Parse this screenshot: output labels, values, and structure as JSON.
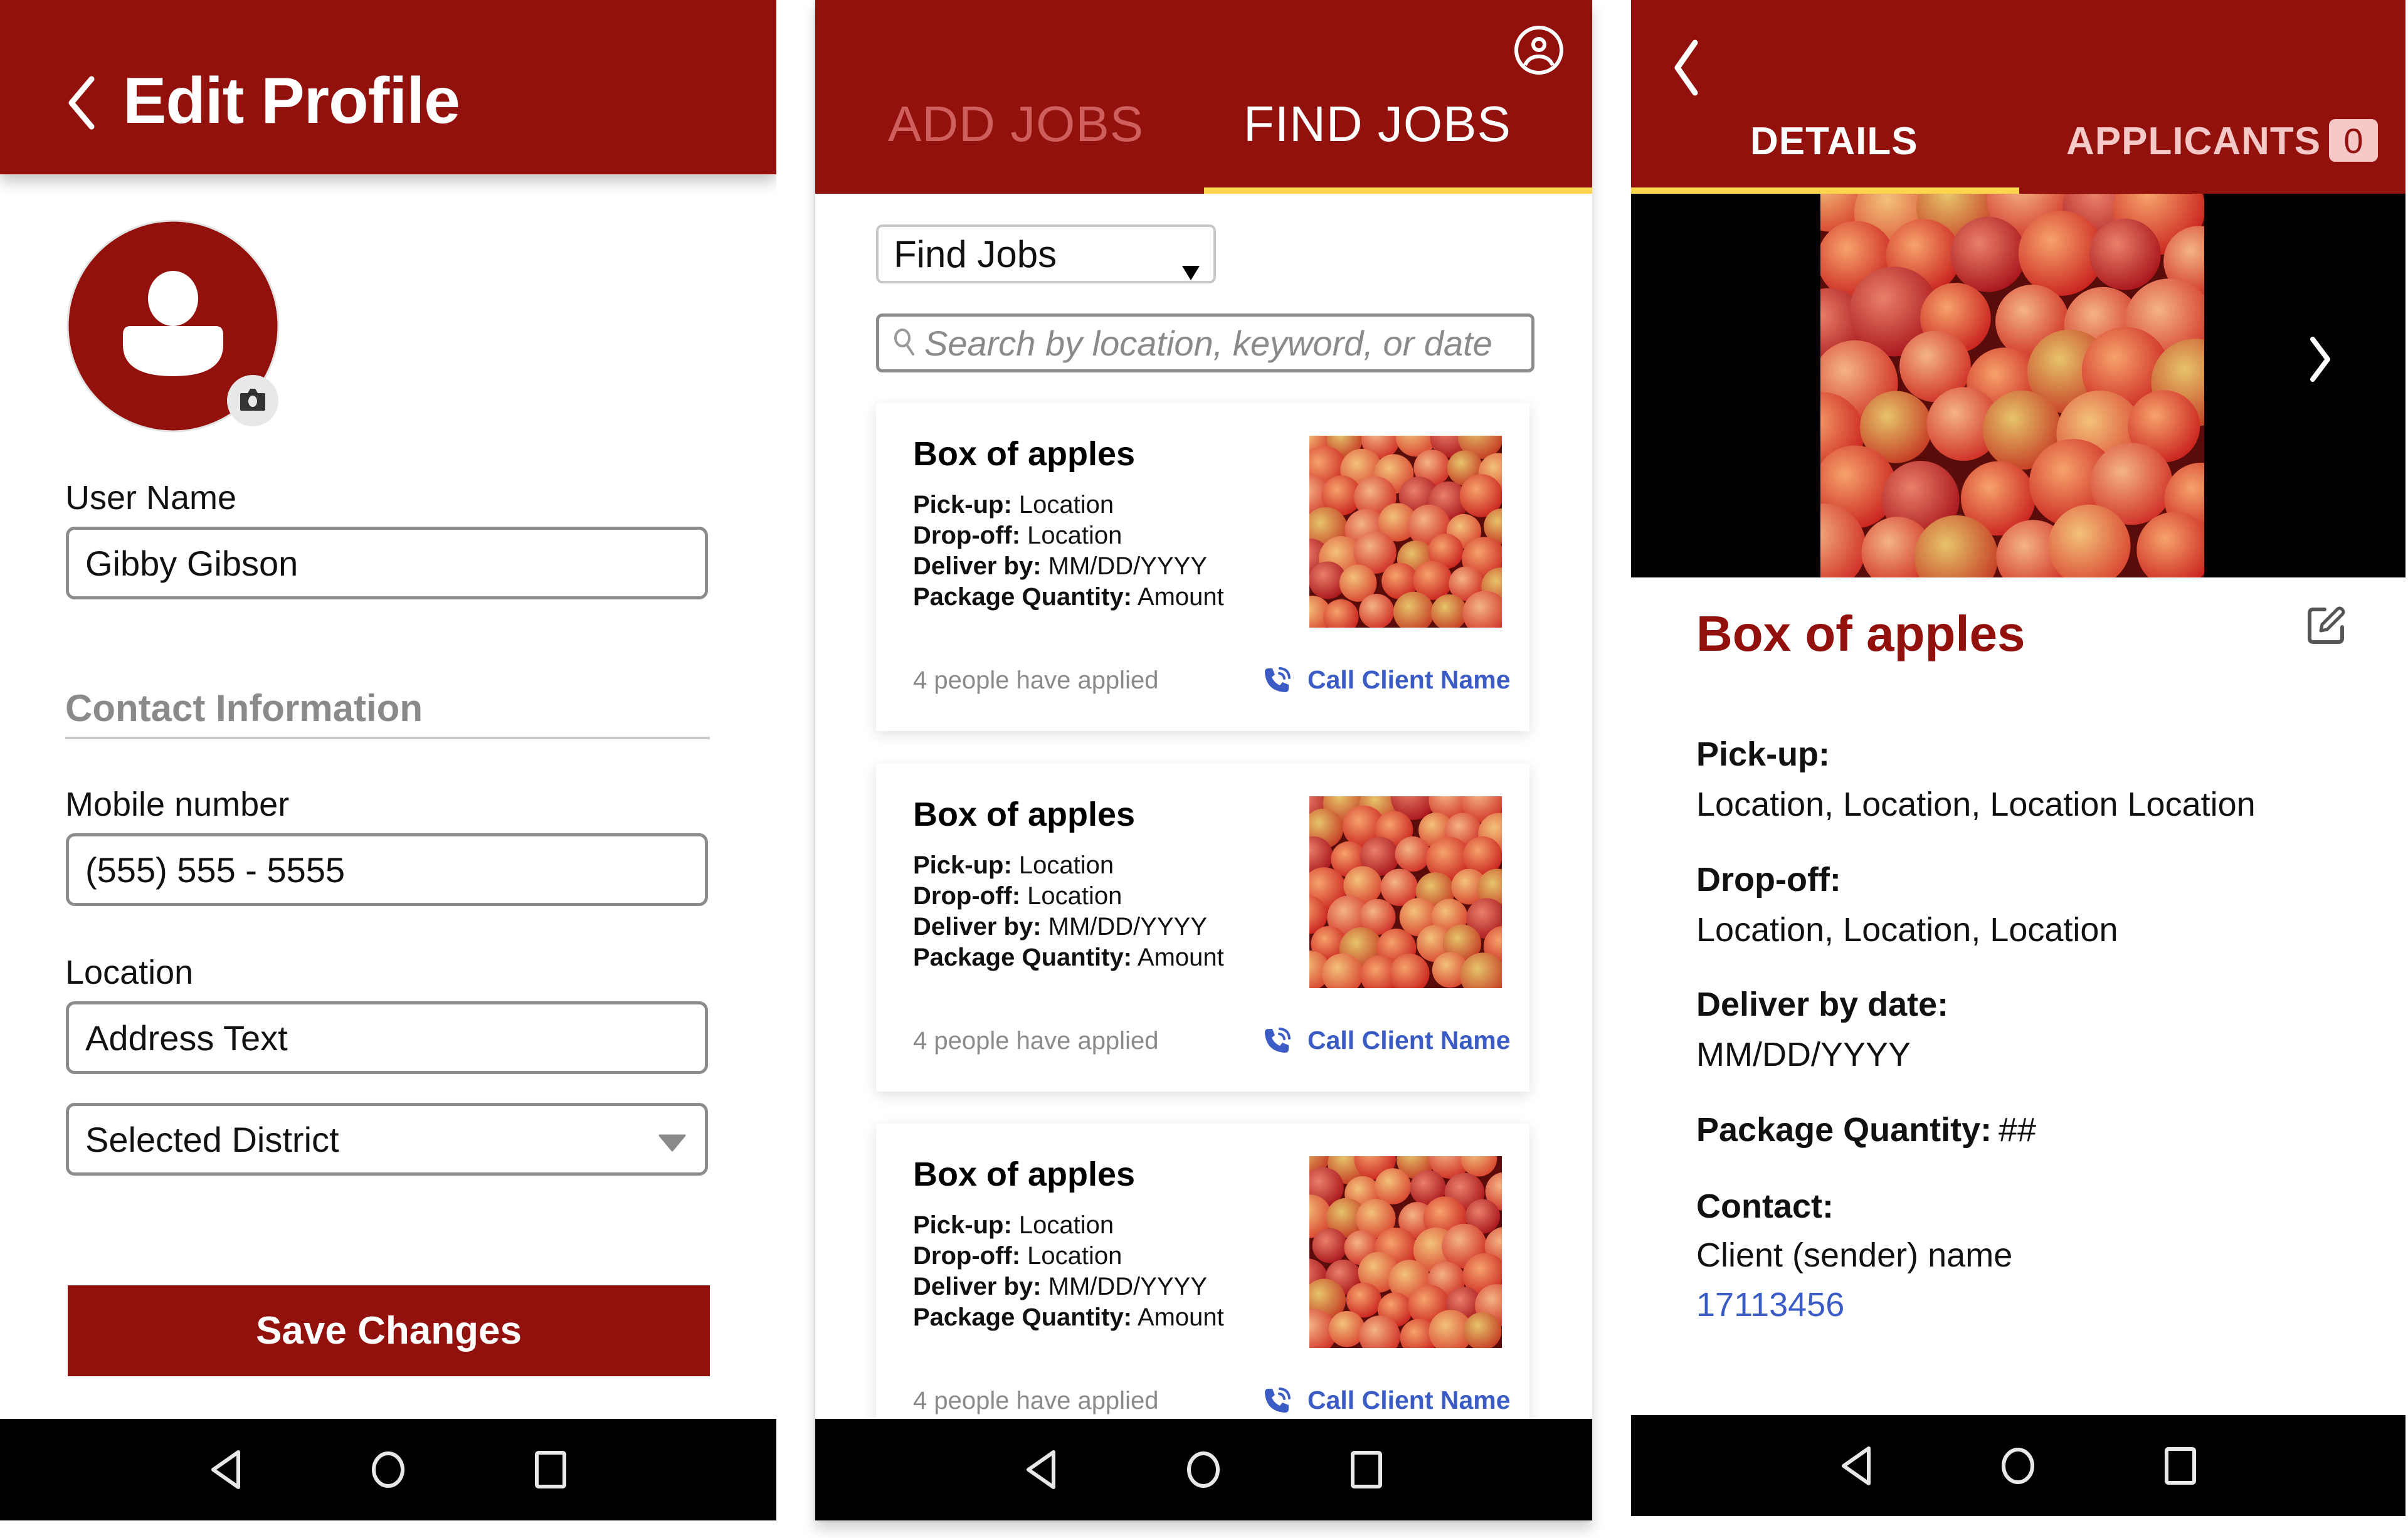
{
  "colors": {
    "brand_red": "#93110d",
    "tab_indicator": "#fdd54a",
    "link_blue": "#3b5cc4",
    "muted_gray": "#8a8a8a",
    "badge_bg": "#f5c9c8",
    "inactive_tab_add_jobs": "#cf5f5c",
    "inactive_tab_applicants": "#f5c9c8"
  },
  "edit_profile": {
    "title": "Edit Profile",
    "back_icon": "chevron-left-icon",
    "avatar_icon": "user-avatar-icon",
    "camera_icon": "camera-icon",
    "user_name_label": "User Name",
    "user_name_value": "Gibby Gibson",
    "section_title": "Contact Information",
    "mobile_label": "Mobile number",
    "mobile_value": "(555) 555 - 5555",
    "location_label": "Location",
    "address_value": "Address Text",
    "district_value": "Selected District",
    "save_label": "Save Changes"
  },
  "find_jobs": {
    "tabs": [
      {
        "label": "ADD JOBS",
        "active": false
      },
      {
        "label": "FIND JOBS",
        "active": true
      }
    ],
    "profile_icon": "account-circle-icon",
    "filter_value": "Find Jobs",
    "search_placeholder": "Search by location, keyword, or date",
    "cards": [
      {
        "title": "Box of apples",
        "pickup_label": "Pick-up:",
        "pickup": "Location",
        "dropoff_label": "Drop-off:",
        "dropoff": "Location",
        "deliver_label": "Deliver by:",
        "deliver": "MM/DD/YYYY",
        "quantity_label": "Package Quantity:",
        "quantity": "Amount",
        "applied": "4 people have applied",
        "call_label": "Call Client Name"
      },
      {
        "title": "Box of apples",
        "pickup_label": "Pick-up:",
        "pickup": "Location",
        "dropoff_label": "Drop-off:",
        "dropoff": "Location",
        "deliver_label": "Deliver by:",
        "deliver": "MM/DD/YYYY",
        "quantity_label": "Package Quantity:",
        "quantity": "Amount",
        "applied": "4 people have applied",
        "call_label": "Call Client Name"
      },
      {
        "title": "Box of apples",
        "pickup_label": "Pick-up:",
        "pickup": "Location",
        "dropoff_label": "Drop-off:",
        "dropoff": "Location",
        "deliver_label": "Deliver by:",
        "deliver": "MM/DD/YYYY",
        "quantity_label": "Package Quantity:",
        "quantity": "Amount",
        "applied": "4 people have applied",
        "call_label": "Call Client Name"
      }
    ]
  },
  "job_details": {
    "tabs": [
      {
        "label": "DETAILS",
        "active": true
      },
      {
        "label": "APPLICANTS",
        "active": false,
        "badge": "0"
      }
    ],
    "title": "Box of apples",
    "pickup_label": "Pick-up:",
    "pickup_value": "Location, Location, Location Location",
    "dropoff_label": "Drop-off:",
    "dropoff_value": "Location, Location, Location",
    "deliver_label": "Deliver by date:",
    "deliver_value": "MM/DD/YYYY",
    "quantity_label": "Package Quantity:",
    "quantity_value": "##",
    "contact_label": "Contact:",
    "contact_name": "Client (sender) name",
    "contact_phone": "17113456"
  },
  "system_nav": {
    "back_icon": "nav-back-icon",
    "home_icon": "nav-home-icon",
    "recents_icon": "nav-recents-icon"
  }
}
